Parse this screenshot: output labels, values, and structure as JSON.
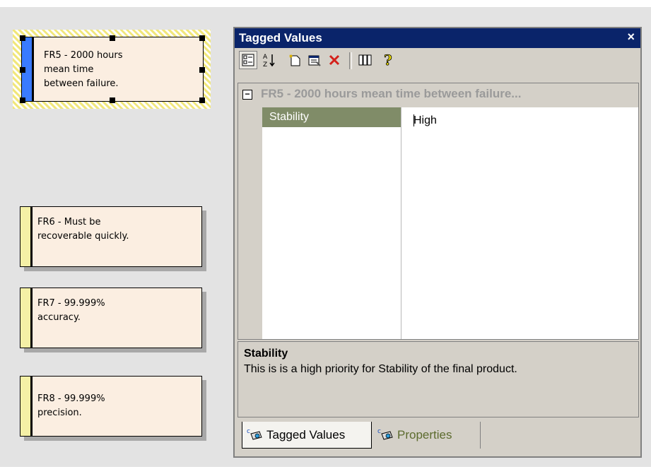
{
  "diagram": {
    "requirements": [
      {
        "id": "fr5",
        "text": "FR5 - 2000 hours\nmean time\nbetween failure."
      },
      {
        "id": "fr6",
        "text": "FR6 - Must be\nrecoverable quickly."
      },
      {
        "id": "fr7",
        "text": "FR7 - 99.999%\naccuracy."
      },
      {
        "id": "fr8",
        "text": "FR8 - 99.999%\nprecision."
      }
    ]
  },
  "panel": {
    "title": "Tagged Values",
    "close_glyph": "×",
    "toolbar_icons": [
      "categorized-icon",
      "sort-alpha-icon",
      "new-tag-icon",
      "properties-icon",
      "delete-icon",
      "columns-icon",
      "help-icon"
    ],
    "group_label": "FR5 - 2000 hours mean time between failure...",
    "expander": "⊟",
    "property": {
      "name": "Stability",
      "value": "High"
    },
    "description": {
      "title": "Stability",
      "text": "This is is a high priority for Stability of the final product."
    },
    "tabs": [
      {
        "label": "Tagged Values",
        "active": true
      },
      {
        "label": "Properties",
        "active": false
      }
    ]
  },
  "colors": {
    "title_bar": "#0a246a",
    "selected_row": "#808c68",
    "note_fill": "#fbeee1",
    "note_stripe": "#f4f0a6",
    "selected_stripe": "#3a7bff"
  }
}
